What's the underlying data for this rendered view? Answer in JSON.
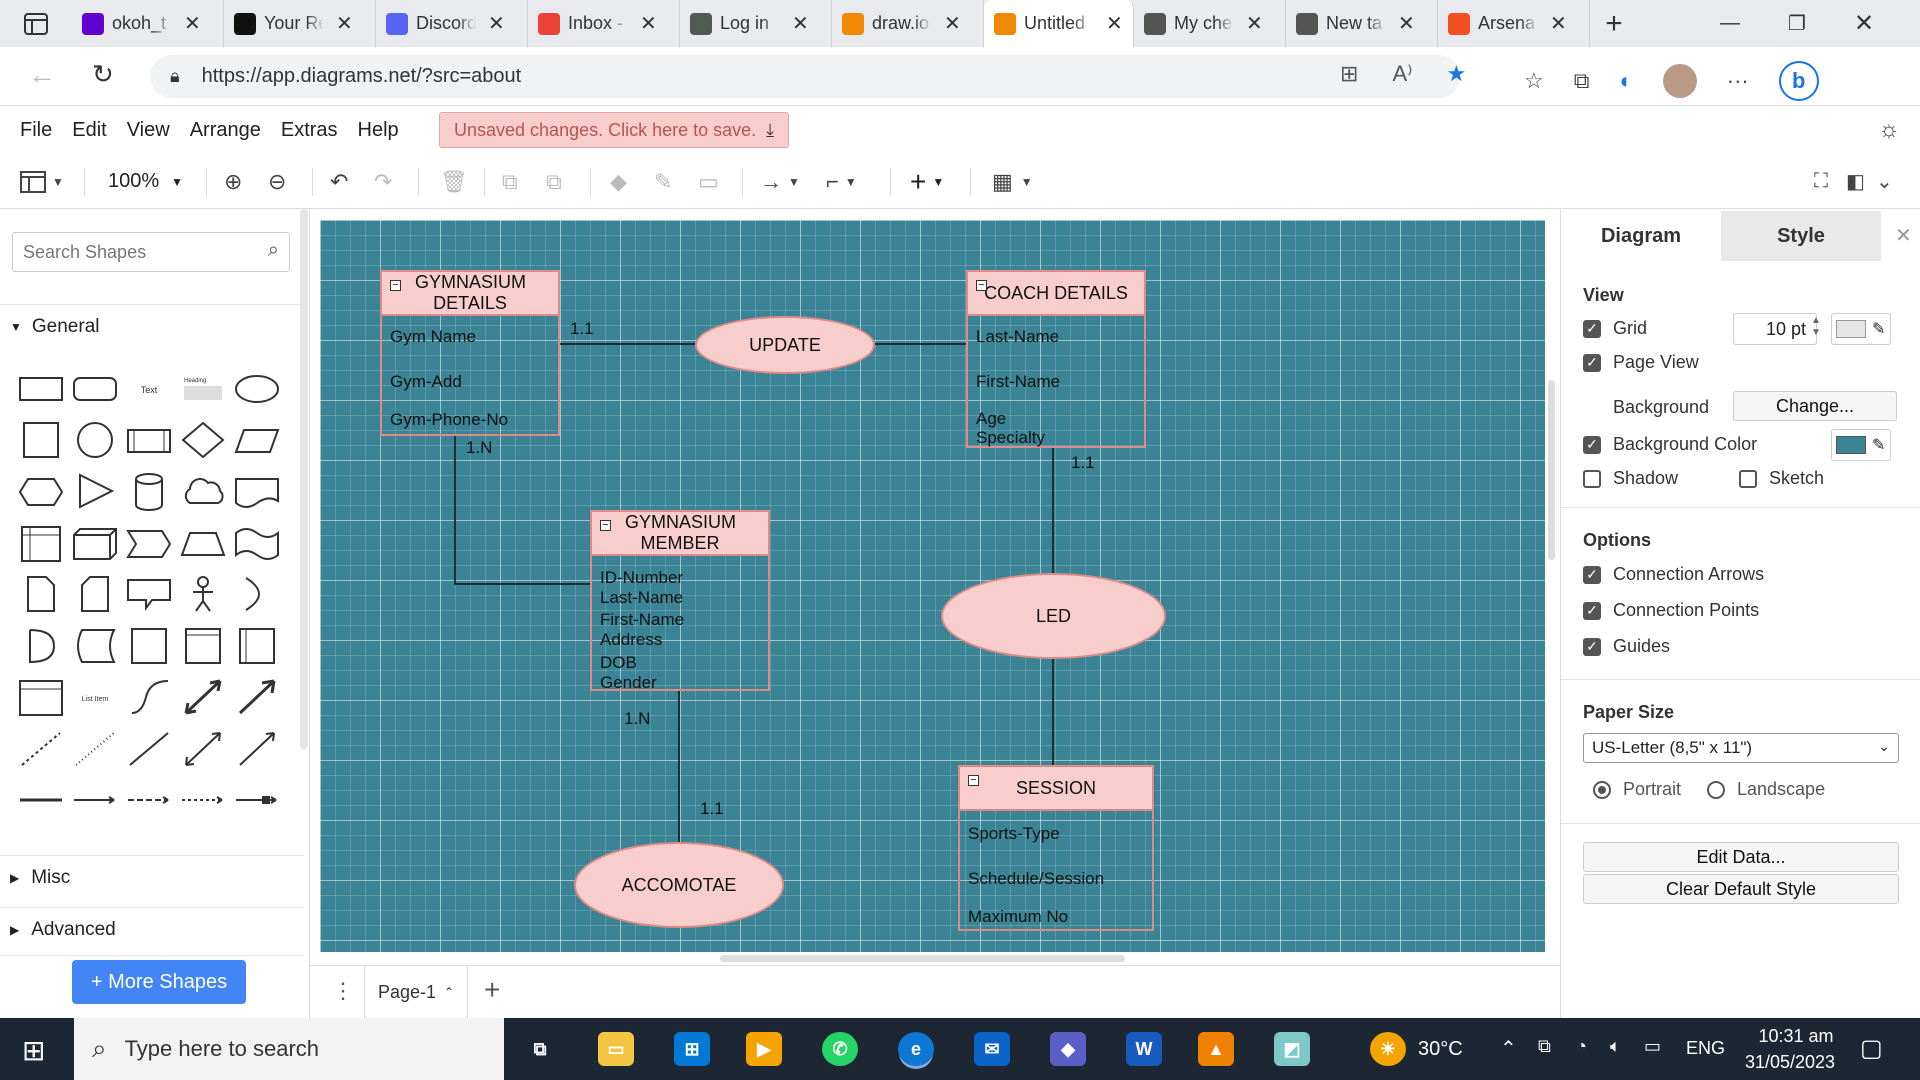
{
  "browser": {
    "tabs": [
      {
        "title": "okoh_t",
        "icon": "yahoo-mail-icon",
        "color": "#6001d2"
      },
      {
        "title": "Your Re",
        "icon": "github-icon",
        "color": "#111111"
      },
      {
        "title": "Discord",
        "icon": "discord-icon",
        "color": "#5865f2"
      },
      {
        "title": "Inbox -",
        "icon": "gmail-icon",
        "color": "#ea4335"
      },
      {
        "title": "Log in",
        "icon": "leaf-icon",
        "color": "#4f5b53"
      },
      {
        "title": "draw.io",
        "icon": "drawio-icon",
        "color": "#f08705"
      },
      {
        "title": "Untitled",
        "icon": "drawio-icon",
        "color": "#f08705"
      },
      {
        "title": "My che",
        "icon": "document-icon",
        "color": "#555555"
      },
      {
        "title": "New ta",
        "icon": "new-tab-icon",
        "color": "#555555"
      },
      {
        "title": "Arsena",
        "icon": "microsoft-icon",
        "color": "#f25022"
      }
    ],
    "url": "https://app.diagrams.net/?src=about"
  },
  "menu": {
    "items": [
      "File",
      "Edit",
      "View",
      "Arrange",
      "Extras",
      "Help"
    ],
    "unsaved": "Unsaved changes. Click here to save."
  },
  "toolbar": {
    "zoom": "100%"
  },
  "left_panel": {
    "search_placeholder": "Search Shapes",
    "general_label": "General",
    "misc_label": "Misc",
    "advanced_label": "Advanced",
    "more_shapes": "+ More Shapes",
    "shape_text_label": "Text",
    "shape_heading_label": "Heading",
    "shape_list_label": "List Item"
  },
  "diagram": {
    "entities": {
      "gym": {
        "title": "GYMNASIUM DETAILS",
        "attrs": [
          "Gym Name",
          "Gym-Add",
          "Gym-Phone-No"
        ]
      },
      "coach": {
        "title": "COACH DETAILS",
        "attrs": [
          "Last-Name",
          "First-Name",
          "Age",
          "Specialty"
        ]
      },
      "member": {
        "title": "GYMNASIUM MEMBER",
        "attrs": [
          "ID-Number",
          "Last-Name",
          "First-Name",
          "Address",
          "DOB",
          "Gender"
        ]
      },
      "session": {
        "title": "SESSION",
        "attrs": [
          "Sports-Type",
          "Schedule/Session",
          "Maximum No"
        ]
      }
    },
    "relationships": {
      "update": "UPDATE",
      "led": "LED",
      "accomodate": "ACCOMOTAE"
    },
    "cardinalities": {
      "gym_update": "1.1",
      "gym_member": "1.N",
      "coach_led": "1.1",
      "member_acc": "1.N",
      "acc_member": "1.1"
    }
  },
  "right_panel": {
    "tab_diagram": "Diagram",
    "tab_style": "Style",
    "view_heading": "View",
    "grid": {
      "label": "Grid",
      "checked": true,
      "size": "10 pt"
    },
    "page_view": {
      "label": "Page View",
      "checked": true
    },
    "background_label": "Background",
    "change_button": "Change...",
    "background_color": {
      "label": "Background Color",
      "checked": true,
      "value": "#3b8496"
    },
    "shadow": {
      "label": "Shadow",
      "checked": false
    },
    "sketch": {
      "label": "Sketch",
      "checked": false
    },
    "options_heading": "Options",
    "connection_arrows": {
      "label": "Connection Arrows",
      "checked": true
    },
    "connection_points": {
      "label": "Connection Points",
      "checked": true
    },
    "guides": {
      "label": "Guides",
      "checked": true
    },
    "paper_size_heading": "Paper Size",
    "paper_size": "US-Letter (8,5\" x 11\")",
    "portrait": "Portrait",
    "landscape": "Landscape",
    "edit_data": "Edit Data...",
    "clear_style": "Clear Default Style"
  },
  "pages": {
    "current": "Page-1"
  },
  "taskbar": {
    "search_placeholder": "Type here to search",
    "temperature": "30°C",
    "language": "ENG",
    "time": "10:31 am",
    "date": "31/05/2023"
  },
  "colors": {
    "canvas": "#3b8496",
    "entity_fill": "#f8cecc",
    "entity_stroke": "#e08a87",
    "accent": "#4285f4"
  }
}
